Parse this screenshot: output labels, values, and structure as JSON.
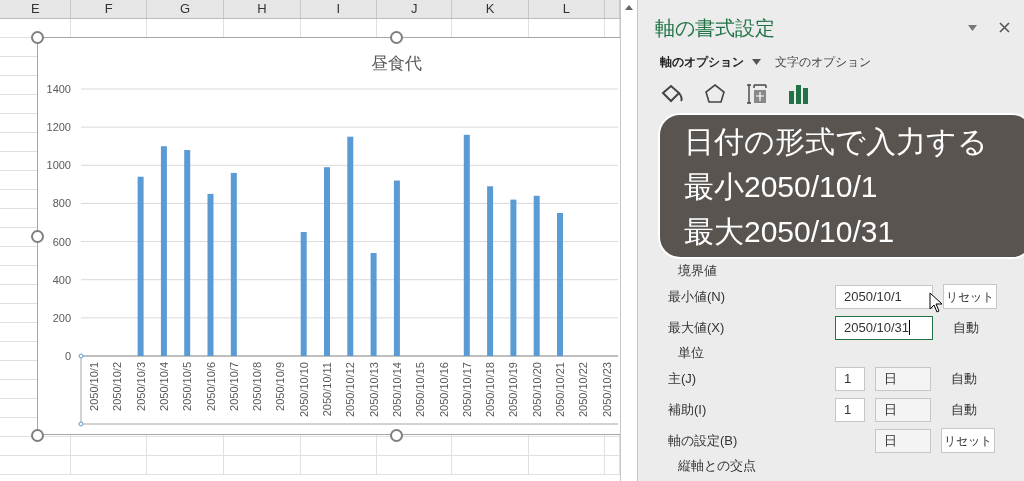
{
  "sheet": {
    "columns": [
      "E",
      "F",
      "G",
      "H",
      "I",
      "J",
      "K",
      "L"
    ]
  },
  "chart": {
    "chart_data": {
      "type": "bar",
      "title": "昼食代",
      "categories": [
        "2050/10/1",
        "2050/10/2",
        "2050/10/3",
        "2050/10/4",
        "2050/10/5",
        "2050/10/6",
        "2050/10/7",
        "2050/10/8",
        "2050/10/9",
        "2050/10/10",
        "2050/10/11",
        "2050/10/12",
        "2050/10/13",
        "2050/10/14",
        "2050/10/15",
        "2050/10/16",
        "2050/10/17",
        "2050/10/18",
        "2050/10/19",
        "2050/10/20",
        "2050/10/21",
        "2050/10/22",
        "2050/10/23"
      ],
      "grid": true,
      "series": [
        {
          "color": "#5b9bd5",
          "values": [
            null,
            null,
            940,
            1100,
            1080,
            850,
            960,
            null,
            null,
            650,
            990,
            1150,
            540,
            920,
            null,
            null,
            1160,
            890,
            820,
            840,
            750,
            null,
            null
          ]
        }
      ],
      "ylim": [
        0,
        1400
      ],
      "yticks": [
        0,
        200,
        400,
        600,
        800,
        1000,
        1200,
        1400
      ]
    }
  },
  "panel": {
    "title": "軸の書式設定",
    "tabs": [
      {
        "label": "軸のオプション",
        "selected": true
      },
      {
        "label": "文字のオプション",
        "selected": false
      }
    ],
    "icon_tabs": [
      {
        "kind": "fill",
        "selected": false
      },
      {
        "kind": "effects",
        "selected": false
      },
      {
        "kind": "size",
        "selected": false
      },
      {
        "kind": "options",
        "selected": true
      }
    ],
    "overlay": {
      "lines": [
        "日付の形式で入力する",
        "最小2050/10/1",
        "最大2050/10/31"
      ]
    },
    "sections": [
      {
        "heading": "境界値",
        "rows": [
          {
            "label": "最小値(N)",
            "kind": "input",
            "value": "2050/10/1",
            "focused": false,
            "action": "リセット"
          },
          {
            "label": "最大値(X)",
            "kind": "input",
            "value": "2050/10/31",
            "focused": true,
            "status": "自動"
          }
        ]
      },
      {
        "heading": "単位",
        "rows": [
          {
            "label": "主(J)",
            "kind": "unit",
            "value": "1",
            "unit": "日",
            "status": "自動"
          },
          {
            "label": "補助(I)",
            "kind": "unit",
            "value": "1",
            "unit": "日",
            "status": "自動"
          },
          {
            "label": "軸の設定(B)",
            "kind": "select",
            "unit": "日",
            "action": "リセット"
          }
        ]
      },
      {
        "heading": "縦軸との交点"
      }
    ]
  }
}
